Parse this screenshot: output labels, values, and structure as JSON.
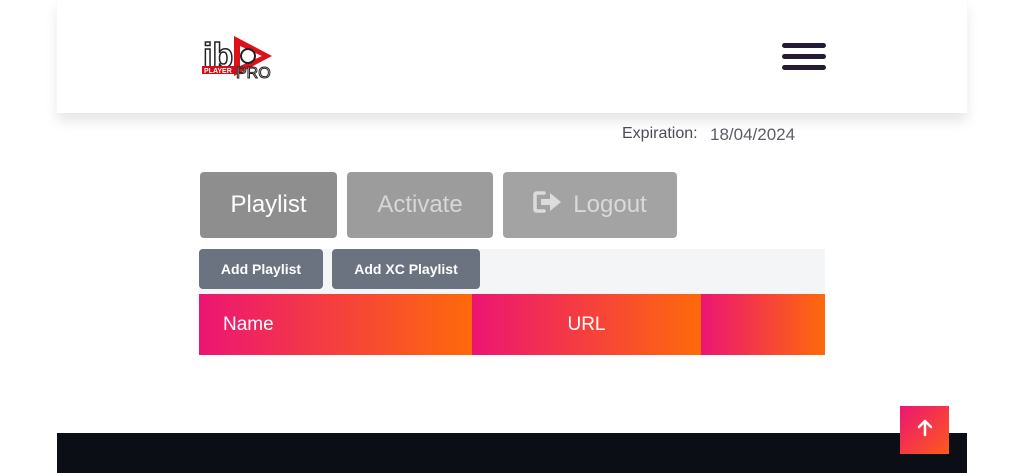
{
  "header": {
    "logo": {
      "text_main": "ib",
      "text_sub": "PLAYER",
      "text_pro": "PRO"
    },
    "menu_icon": "hamburger-menu-icon"
  },
  "account": {
    "expiration_label": "Expiration:",
    "expiration_value": "18/04/2024"
  },
  "tabs": [
    {
      "label": "Playlist",
      "icon": null
    },
    {
      "label": "Activate",
      "icon": null
    },
    {
      "label": "Logout",
      "icon": "sign-out-icon"
    }
  ],
  "toolbar": {
    "add_playlist": "Add Playlist",
    "add_xc_playlist": "Add XC Playlist"
  },
  "table": {
    "columns": [
      "Name",
      "URL",
      ""
    ]
  },
  "scroll_top_icon": "arrow-up-icon",
  "colors": {
    "accent_gradient_start": "#ec1573",
    "accent_gradient_end": "#fe6a0a",
    "menu_dark": "#231b35",
    "footer": "#0b0e14",
    "button_gray": "#6b7280"
  }
}
